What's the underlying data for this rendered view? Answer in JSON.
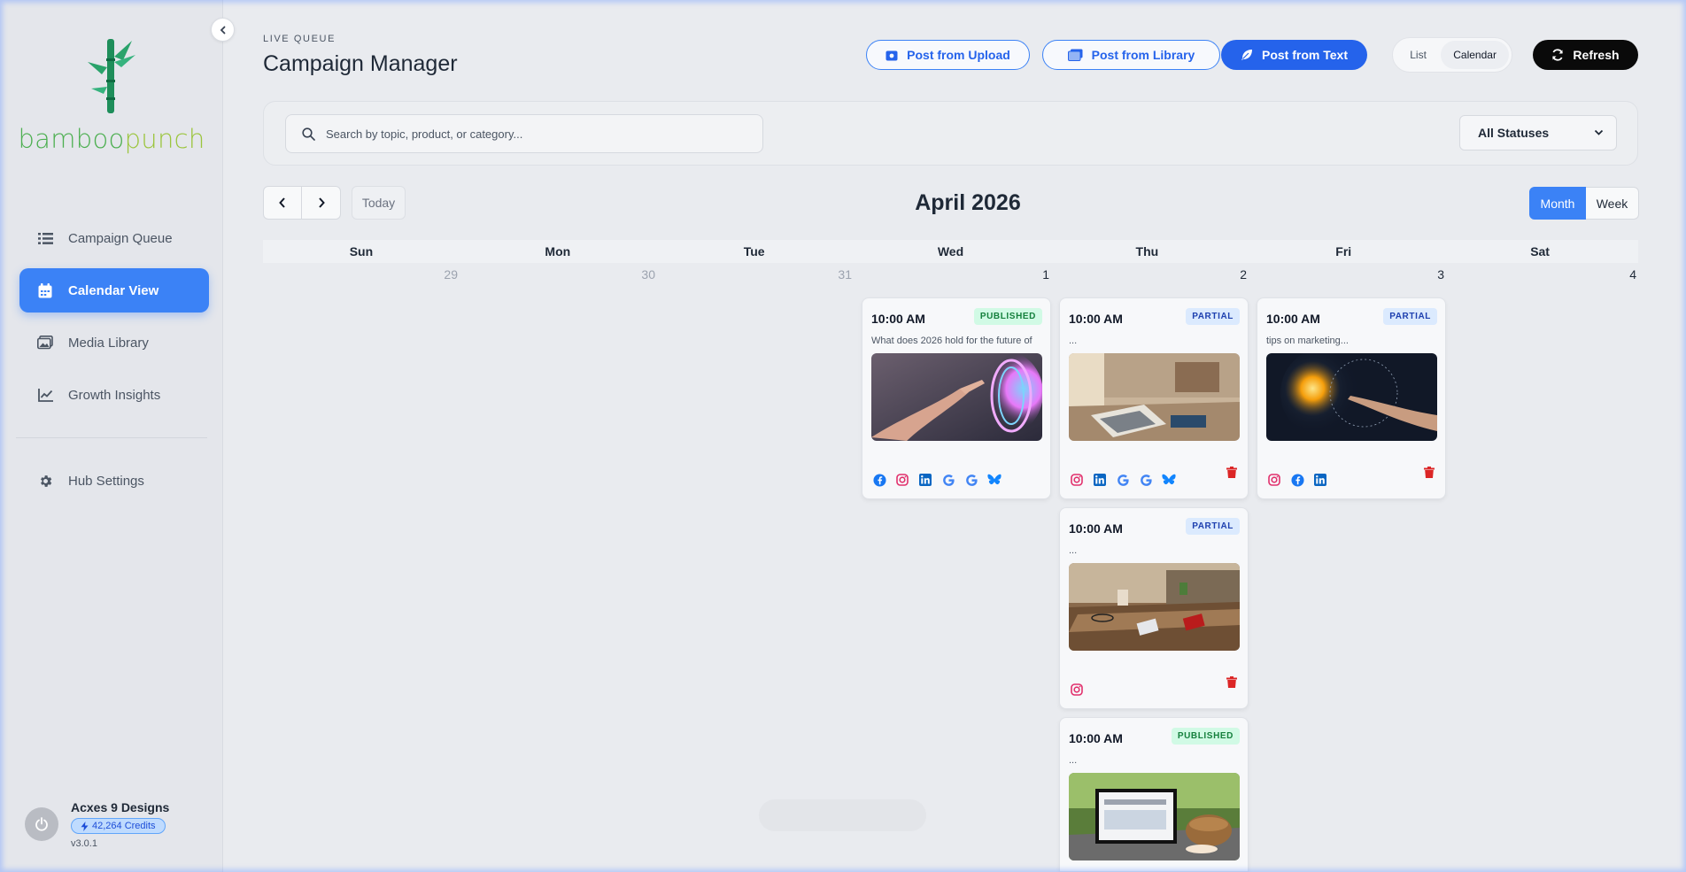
{
  "brand": {
    "part1": "bamboo",
    "part2": "punch"
  },
  "sidebar": {
    "items": [
      {
        "label": "Campaign Queue",
        "icon": "list-icon",
        "active": false
      },
      {
        "label": "Calendar View",
        "icon": "calendar-icon",
        "active": true
      },
      {
        "label": "Media Library",
        "icon": "images-icon",
        "active": false
      },
      {
        "label": "Growth Insights",
        "icon": "chart-line-icon",
        "active": false
      }
    ],
    "settings": {
      "label": "Hub Settings",
      "icon": "gear-icon"
    }
  },
  "account": {
    "name": "Acxes 9 Designs",
    "credits": "42,264 Credits",
    "version": "v3.0.1"
  },
  "header": {
    "eyebrow": "LIVE QUEUE",
    "title": "Campaign Manager",
    "post_upload": "Post from Upload",
    "post_library": "Post from Library",
    "post_text": "Post from Text",
    "view_list": "List",
    "view_calendar": "Calendar",
    "refresh": "Refresh"
  },
  "search": {
    "placeholder": "Search by topic, product, or category..."
  },
  "status_filter": {
    "selected": "All Statuses"
  },
  "calendar": {
    "today": "Today",
    "month_label": "April 2026",
    "views": [
      "Month",
      "Week"
    ],
    "weekdays": [
      "Sun",
      "Mon",
      "Tue",
      "Wed",
      "Thu",
      "Fri",
      "Sat"
    ],
    "dates": [
      "29",
      "30",
      "31",
      "1",
      "2",
      "3",
      "4"
    ]
  },
  "posts": [
    {
      "time": "10:00 AM",
      "status": "PUBLISHED",
      "text": "What does 2026 hold for the future of",
      "platforms": [
        "facebook",
        "instagram",
        "linkedin",
        "google",
        "google",
        "bluesky"
      ]
    },
    {
      "time": "10:00 AM",
      "status": "PARTIAL",
      "text": "...",
      "platforms": [
        "instagram",
        "linkedin",
        "google",
        "google",
        "bluesky"
      ]
    },
    {
      "time": "10:00 AM",
      "status": "PARTIAL",
      "text": "tips on marketing...",
      "platforms": [
        "instagram",
        "facebook",
        "linkedin"
      ]
    },
    {
      "time": "10:00 AM",
      "status": "PARTIAL",
      "text": "...",
      "platforms": [
        "instagram"
      ]
    },
    {
      "time": "10:00 AM",
      "status": "PUBLISHED",
      "text": "...",
      "platforms": []
    }
  ],
  "colors": {
    "accent": "#3b82f6",
    "published": "#15803d",
    "partial": "#1e40af",
    "danger": "#dc2626"
  }
}
